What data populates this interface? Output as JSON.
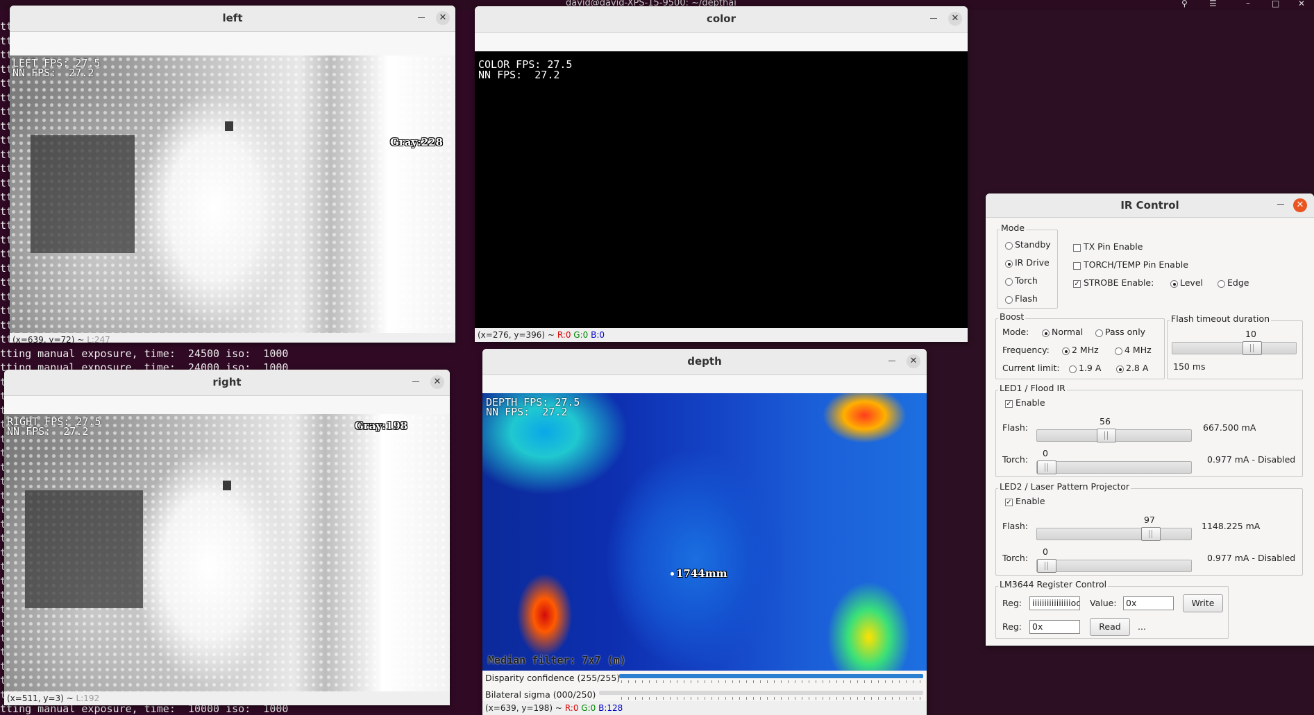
{
  "topbar": {
    "title": "david@david-XPS-15-9500: ~/depthai"
  },
  "terminal": {
    "prefix": "tt",
    "lines": [
      "tting manual exposure, time:  24500 iso:  1000",
      "tting manual exposure, time:  24000 iso:  1000",
      "tting manual exposure, time:  10000 iso:  1000"
    ]
  },
  "left_window": {
    "title": "left",
    "overlay_fps": "LEFT FPS: 27.5",
    "overlay_nn": "NN FPS:  27.2",
    "gray_label": "Gray:228",
    "status_coords": "(x=639, y=72) ~",
    "status_value": "L:247"
  },
  "right_window": {
    "title": "right",
    "overlay_fps": "RIGHT FPS: 27.5",
    "overlay_nn": "NN FPS:  27.2",
    "gray_label": "Gray:198",
    "status_coords": "(x=511, y=3) ~",
    "status_value": "L:192"
  },
  "color_window": {
    "title": "color",
    "overlay_fps": "COLOR FPS: 27.5",
    "overlay_nn": "NN FPS:  27.2",
    "status_coords": "(x=276, y=396) ~",
    "status_r": "R:0",
    "status_g": "G:0",
    "status_b": "B:0"
  },
  "depth_window": {
    "title": "depth",
    "overlay_fps": "DEPTH FPS: 27.5",
    "overlay_nn": "NN FPS:  27.2",
    "distance_label": "1744mm",
    "bottom_overlay": "Median filter: 7x7 (m)",
    "trackbars": [
      {
        "label": "Disparity confidence (255/255)",
        "value": 255,
        "max": 255
      },
      {
        "label": "Bilateral sigma (000/250)",
        "value": 0,
        "max": 250
      }
    ],
    "status_coords": "(x=639, y=198) ~",
    "status_r": "R:0",
    "status_g": "G:0",
    "status_b": "B:128"
  },
  "ir_control": {
    "title": "IR Control",
    "mode": {
      "label": "Mode",
      "options": [
        "Standby",
        "IR Drive",
        "Torch",
        "Flash"
      ],
      "selected": "IR Drive"
    },
    "tx_pin": {
      "label": "TX Pin Enable",
      "checked": false
    },
    "torch_pin": {
      "label": "TORCH/TEMP Pin Enable",
      "checked": false
    },
    "strobe": {
      "label": "STROBE Enable:",
      "checked": true,
      "options": [
        "Level",
        "Edge"
      ],
      "selected": "Level"
    },
    "boost": {
      "label": "Boost",
      "mode_label": "Mode:",
      "mode_options": [
        "Normal",
        "Pass only"
      ],
      "mode_selected": "Normal",
      "freq_label": "Frequency:",
      "freq_options": [
        "2 MHz",
        "4 MHz"
      ],
      "freq_selected": "2 MHz",
      "current_label": "Current limit:",
      "current_options": [
        "1.9 A",
        "2.8 A"
      ],
      "current_selected": "2.8 A"
    },
    "flash_timeout": {
      "label": "Flash timeout duration",
      "value": 10,
      "max": 15,
      "display": "150 ms"
    },
    "led1": {
      "label": "LED1 / Flood IR",
      "enable_label": "Enable",
      "enabled": true,
      "flash_label": "Flash:",
      "flash_value": 56,
      "flash_max": 127,
      "flash_display": "667.500 mA",
      "torch_label": "Torch:",
      "torch_value": 0,
      "torch_max": 127,
      "torch_display": "0.977 mA - Disabled"
    },
    "led2": {
      "label": "LED2 / Laser Pattern Projector",
      "enable_label": "Enable",
      "enabled": true,
      "flash_label": "Flash:",
      "flash_value": 97,
      "flash_max": 127,
      "flash_display": "1148.225 mA",
      "torch_label": "Torch:",
      "torch_value": 0,
      "torch_max": 127,
      "torch_display": "0.977 mA - Disabled"
    },
    "lm3644": {
      "label": "LM3644 Register Control",
      "reg_label": "Reg:",
      "reg_write_value": "iiiiiiiiiiiiiiiioooj",
      "value_label": "Value:",
      "value_value": "0x",
      "write_label": "Write",
      "reg_read_value": "0x",
      "read_label": "Read",
      "read_result": "..."
    }
  }
}
